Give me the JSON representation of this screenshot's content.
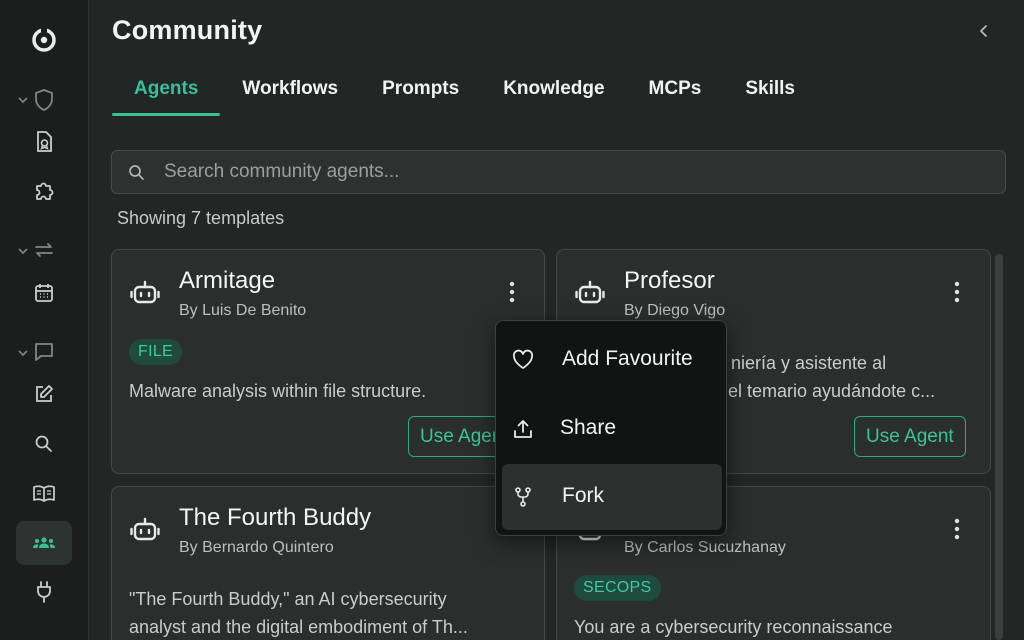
{
  "page": {
    "title": "Community"
  },
  "tabs": [
    {
      "label": "Agents",
      "active": true
    },
    {
      "label": "Workflows",
      "active": false
    },
    {
      "label": "Prompts",
      "active": false
    },
    {
      "label": "Knowledge",
      "active": false
    },
    {
      "label": "MCPs",
      "active": false
    },
    {
      "label": "Skills",
      "active": false
    }
  ],
  "search": {
    "placeholder": "Search community agents...",
    "value": ""
  },
  "results": {
    "count_text": "Showing 7 templates"
  },
  "cards": [
    {
      "title": "Armitage",
      "author": "By Luis De Benito",
      "tag": "FILE",
      "description": "Malware analysis within file structure.",
      "button": "Use Agent"
    },
    {
      "title": "Profesor",
      "author": "By Diego Vigo",
      "description_line1": "niería y asistente al",
      "description_line2": "el temario ayudándote c...",
      "button": "Use Agent"
    },
    {
      "title": "The Fourth Buddy",
      "author": "By Bernardo Quintero",
      "description_line1": "\"The Fourth Buddy,\" an AI cybersecurity",
      "description_line2": "analyst and the digital embodiment of Th..."
    },
    {
      "author": "By Carlos Sucuzhanay",
      "tag": "SECOPS",
      "description": "You are a cybersecurity reconnaissance"
    }
  ],
  "menu": {
    "items": [
      {
        "label": "Add Favourite",
        "icon": "heart-icon"
      },
      {
        "label": "Share",
        "icon": "upload-icon"
      },
      {
        "label": "Fork",
        "icon": "fork-icon"
      }
    ]
  },
  "sidebar": {
    "icons": [
      "logo-icon",
      "shield-icon",
      "file-badge-icon",
      "puzzle-icon",
      "repeat-icon",
      "calendar-icon",
      "chat-icon",
      "edit-icon",
      "search-icon",
      "book-icon",
      "community-icon",
      "plug-icon"
    ],
    "active": "community-icon"
  },
  "colors": {
    "accent": "#3bbf9a",
    "background": "#222624",
    "card": "#2a2e2d",
    "menu": "#121413"
  }
}
